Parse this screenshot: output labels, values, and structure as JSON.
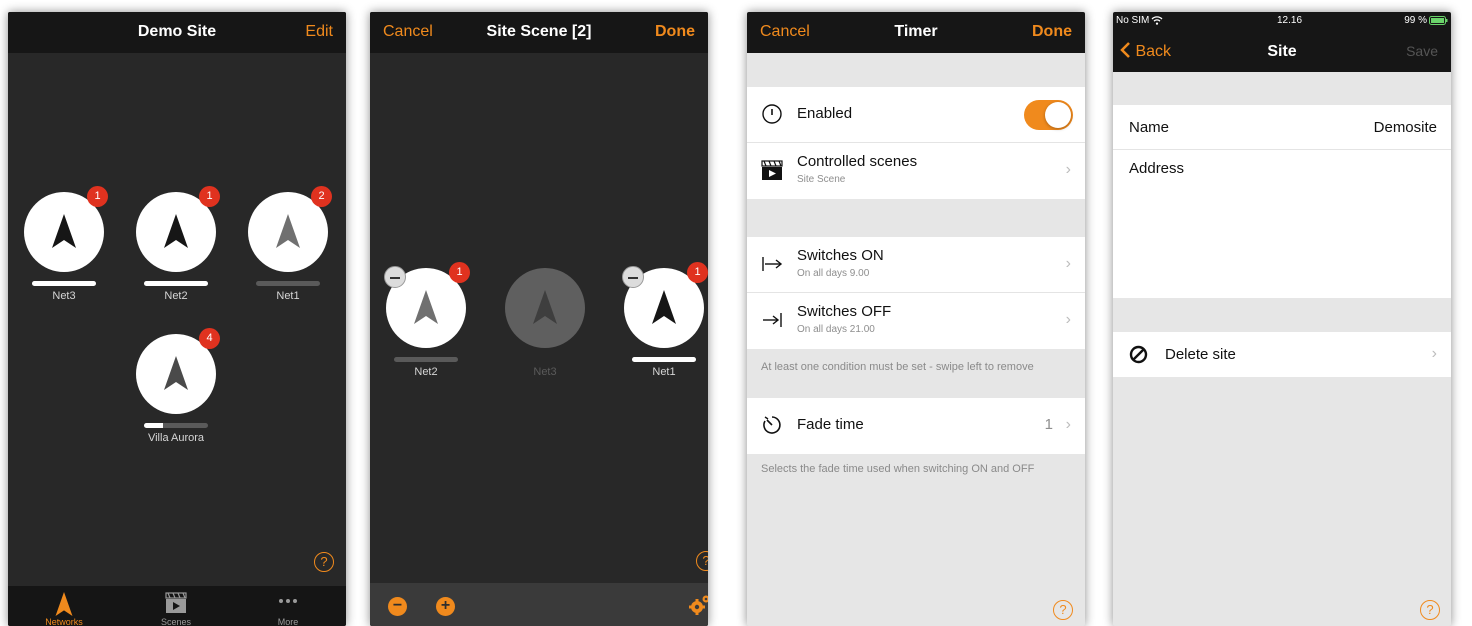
{
  "colors": {
    "accent": "#f08a1d",
    "badge": "#e0321f",
    "dark_bg": "#2b2b2b",
    "light_bg": "#e6e6e6"
  },
  "screen1": {
    "nav": {
      "title": "Demo Site",
      "right": "Edit"
    },
    "networks": [
      {
        "name": "Net3",
        "badge": "1",
        "level": 1.0
      },
      {
        "name": "Net2",
        "badge": "1",
        "level": 1.0
      },
      {
        "name": "Net1",
        "badge": "2",
        "level": 0.0
      },
      {
        "name": "Villa Aurora",
        "badge": "4",
        "level": 0.3
      }
    ],
    "help": "?",
    "tabs": [
      {
        "label": "Networks",
        "icon": "networks-icon",
        "active": true
      },
      {
        "label": "Scenes",
        "icon": "scenes-icon",
        "active": false
      },
      {
        "label": "More",
        "icon": "more-icon",
        "active": false
      }
    ]
  },
  "screen2": {
    "nav": {
      "left": "Cancel",
      "title": "Site Scene [2]",
      "right": "Done"
    },
    "networks": [
      {
        "name": "Net2",
        "badge": "1",
        "state": "included",
        "level": 0.0
      },
      {
        "name": "Net3",
        "badge": "",
        "state": "excluded",
        "level": 0.0
      },
      {
        "name": "Net1",
        "badge": "1",
        "state": "included",
        "level": 1.0
      }
    ],
    "help": "?",
    "toolbar": {
      "remove": "−",
      "add": "+",
      "settings_icon": "gears-icon"
    }
  },
  "screen3": {
    "nav": {
      "left": "Cancel",
      "title": "Timer",
      "right": "Done"
    },
    "enabled": {
      "label": "Enabled",
      "on": true
    },
    "controlled": {
      "title": "Controlled scenes",
      "subtitle": "Site Scene"
    },
    "switches_on": {
      "title": "Switches ON",
      "subtitle": "On all days  9.00"
    },
    "switches_off": {
      "title": "Switches OFF",
      "subtitle": "On all days  21.00"
    },
    "note": "At least one condition must be set - swipe left to remove",
    "fade": {
      "title": "Fade time",
      "value": "1"
    },
    "fade_note": "Selects the fade time used when switching ON and OFF",
    "help": "?"
  },
  "screen4": {
    "status": {
      "carrier": "No SIM",
      "time": "12.16",
      "battery": "99 %"
    },
    "nav": {
      "left": "Back",
      "title": "Site",
      "right": "Save"
    },
    "name": {
      "label": "Name",
      "value": "Demosite"
    },
    "address": {
      "label": "Address",
      "value": ""
    },
    "delete": {
      "label": "Delete site"
    },
    "help": "?"
  }
}
